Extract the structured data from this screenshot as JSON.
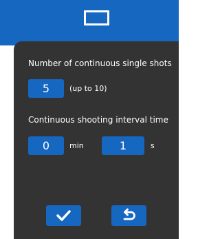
{
  "header": {
    "icon": "rectangle-frame-icon"
  },
  "shots": {
    "label": "Number of continuous single shots",
    "value": "5",
    "hint": "(up to 10)"
  },
  "interval": {
    "label": "Continuous shooting interval time",
    "minutes_value": "0",
    "minutes_unit": "min",
    "seconds_value": "1",
    "seconds_unit": "s"
  },
  "actions": {
    "confirm_icon": "checkmark-icon",
    "back_icon": "return-arrow-icon"
  },
  "colors": {
    "accent": "#1667c0",
    "panel": "#333333",
    "text": "#ffffff"
  }
}
